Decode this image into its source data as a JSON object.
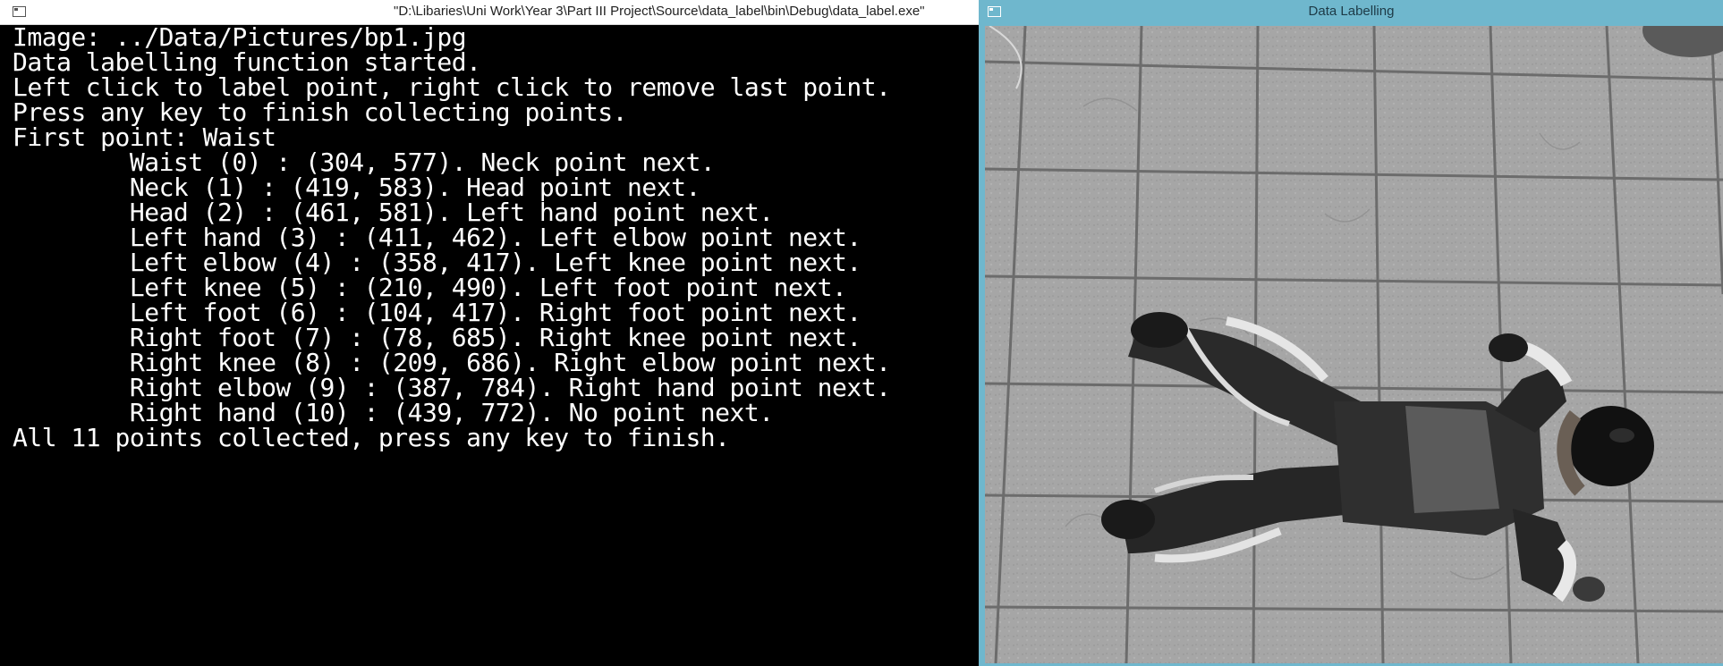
{
  "console": {
    "title": "\"D:\\Libaries\\Uni Work\\Year 3\\Part III Project\\Source\\data_label\\bin\\Debug\\data_label.exe\"",
    "lines": [
      "Image: ../Data/Pictures/bp1.jpg",
      "Data labelling function started.",
      "Left click to label point, right click to remove last point.",
      "Press any key to finish collecting points.",
      "First point: Waist",
      "        Waist (0) : (304, 577). Neck point next.",
      "        Neck (1) : (419, 583). Head point next.",
      "        Head (2) : (461, 581). Left hand point next.",
      "        Left hand (3) : (411, 462). Left elbow point next.",
      "        Left elbow (4) : (358, 417). Left knee point next.",
      "        Left knee (5) : (210, 490). Left foot point next.",
      "        Left foot (6) : (104, 417). Right foot point next.",
      "        Right foot (7) : (78, 685). Right knee point next.",
      "        Right knee (8) : (209, 686). Right elbow point next.",
      "        Right elbow (9) : (387, 784). Right hand point next.",
      "        Right hand (10) : (439, 772). No point next.",
      "All 11 points collected, press any key to finish."
    ]
  },
  "viewer": {
    "title": "Data Labelling",
    "image_description_icon": "grayscale-photo-person-lying-on-tiles"
  },
  "colors": {
    "console_bg": "#000000",
    "console_text": "#ffffff",
    "viewer_frame": "#6fb7cd"
  }
}
